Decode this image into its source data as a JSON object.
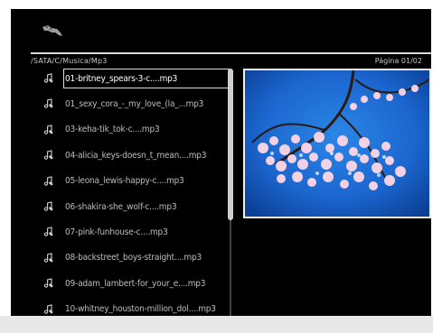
{
  "header": {
    "path": "/SATA/C/Musica/Mp3",
    "page_indicator": "Página 01/02",
    "icon": "remote-control-icon"
  },
  "playlist": {
    "items": [
      {
        "label": "01-britney_spears-3-c....mp3",
        "selected": true
      },
      {
        "label": "01_sexy_cora_-_my_love_(la_...mp3",
        "selected": false
      },
      {
        "label": "03-keha-tik_tok-c....mp3",
        "selected": false
      },
      {
        "label": "04-alicia_keys-doesn_t_mean....mp3",
        "selected": false
      },
      {
        "label": "05-leona_lewis-happy-c....mp3",
        "selected": false
      },
      {
        "label": "06-shakira-she_wolf-c....mp3",
        "selected": false
      },
      {
        "label": "07-pink-funhouse-c....mp3",
        "selected": false
      },
      {
        "label": "08-backstreet_boys-straight....mp3",
        "selected": false
      },
      {
        "label": "09-adam_lambert-for_your_e....mp3",
        "selected": false
      },
      {
        "label": "10-whitney_houston-million_dol....mp3",
        "selected": false
      }
    ],
    "item_icon": "music-note-icon"
  },
  "scroll": {
    "position_fraction": 0.0,
    "visible_fraction": 0.58
  },
  "preview": {
    "description_icon": "cherry-blossom-thumbnail"
  },
  "colors": {
    "background": "#000000",
    "text": "#bdbdbd",
    "text_selected": "#ffffff",
    "sky": "#1d73d9"
  }
}
